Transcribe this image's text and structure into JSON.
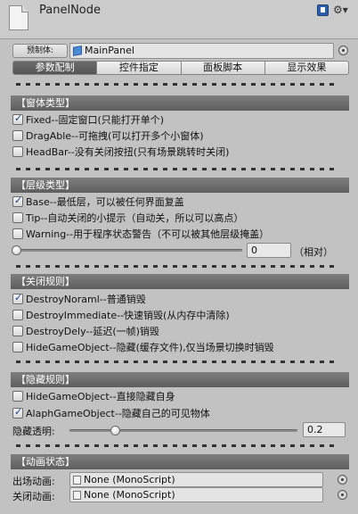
{
  "header": {
    "title": "PanelNode",
    "book_icon": "book-icon",
    "gear_icon": "⚙▾"
  },
  "prefab": {
    "button_label": "预制体:",
    "value": "MainPanel"
  },
  "tabs": [
    {
      "label": "参数配制",
      "active": true
    },
    {
      "label": "控件指定",
      "active": false
    },
    {
      "label": "面板脚本",
      "active": false
    },
    {
      "label": "显示效果",
      "active": false
    }
  ],
  "window_type": {
    "title": "【窗体类型】",
    "options": [
      {
        "label": "Fixed--固定窗口(只能打开单个)",
        "checked": true
      },
      {
        "label": "DragAble--可拖拽(可以打开多个小窗体)",
        "checked": false
      },
      {
        "label": "HeadBar--没有关闭按扭(只有场景跳转时关闭)",
        "checked": false
      }
    ]
  },
  "layer_type": {
    "title": "【层级类型】",
    "options": [
      {
        "label": "Base--最低层，可以被任何界面复盖",
        "checked": true
      },
      {
        "label": "Tip--自动关闭的小提示（自动关，所以可以高点）",
        "checked": false
      },
      {
        "label": "Warning--用于程序状态警告（不可以被其他层级掩盖）",
        "checked": false
      }
    ],
    "slider_value": "0",
    "slider_fraction": 0,
    "relative_label": "（相对）"
  },
  "close_rule": {
    "title": "【关闭规则】",
    "options": [
      {
        "label": "DestroyNoraml--普通销毁",
        "checked": true
      },
      {
        "label": "DestroyImmediate--快速销毁(从内存中清除)",
        "checked": false
      },
      {
        "label": "DestroyDely--延迟(一帧)销毁",
        "checked": false
      },
      {
        "label": "HideGameObject--隐藏(缓存文件),仅当场景切换时销毁",
        "checked": false
      }
    ]
  },
  "hide_rule": {
    "title": "【隐藏规则】",
    "options": [
      {
        "label": "HideGameObject--直接隐藏自身",
        "checked": false
      },
      {
        "label": "AlaphGameObject--隐藏自己的可见物体",
        "checked": true
      }
    ],
    "alpha_label": "隐藏透明:",
    "alpha_value": "0.2",
    "alpha_fraction": 0.2
  },
  "anim_state": {
    "title": "【动画状态】",
    "enter_label": "出场动画:",
    "enter_value": "None (MonoScript)",
    "exit_label": "关闭动画:",
    "exit_value": "None (MonoScript)"
  }
}
